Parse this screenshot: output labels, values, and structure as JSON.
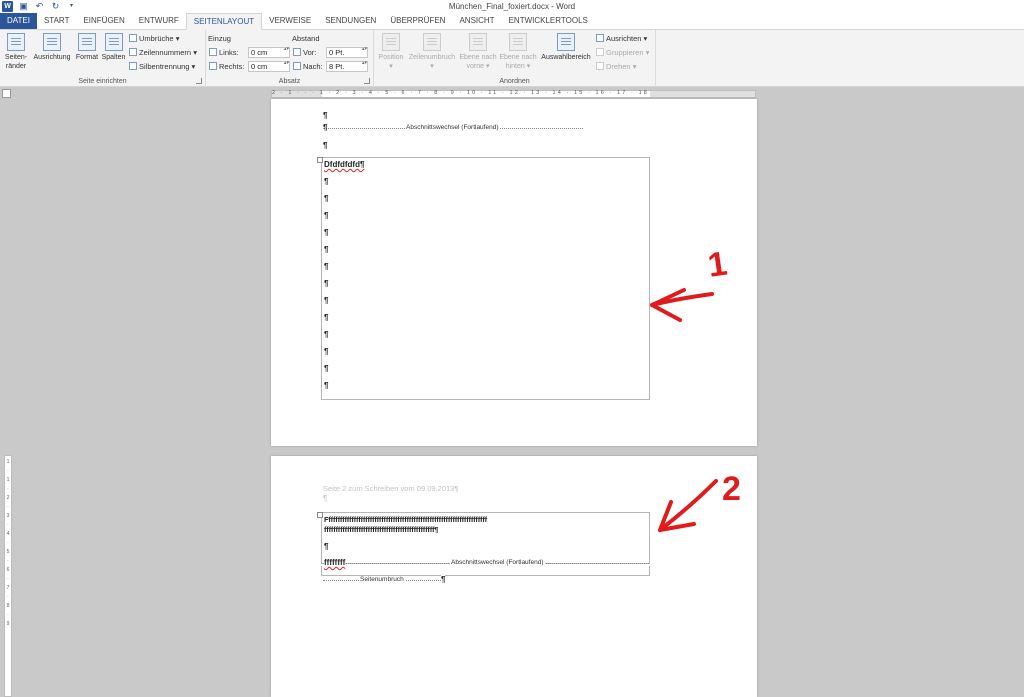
{
  "window": {
    "title": "München_Final_foxiert.docx - Word"
  },
  "tabs": [
    "DATEI",
    "START",
    "EINFÜGEN",
    "ENTWURF",
    "SEITENLAYOUT",
    "VERWEISE",
    "SENDUNGEN",
    "ÜBERPRÜFEN",
    "ANSICHT",
    "ENTWICKLERTOOLS"
  ],
  "ribbon": {
    "seite_einrichten": {
      "label": "Seite einrichten",
      "seitenraender_1": "Seiten-",
      "seitenraender_2": "ränder",
      "ausrichtung": "Ausrichtung",
      "format": "Format",
      "spalten": "Spalten",
      "umbrueche": "Umbrüche",
      "zeilennummern": "Zeilennummern",
      "silbentrennung": "Silbentrennung"
    },
    "absatz": {
      "label": "Absatz",
      "einzug": "Einzug",
      "abstand": "Abstand",
      "links_label": "Links:",
      "links_value": "0 cm",
      "rechts_label": "Rechts:",
      "rechts_value": "0 cm",
      "vor_label": "Vor:",
      "vor_value": "0 Pt.",
      "nach_label": "Nach:",
      "nach_value": "8 Pt."
    },
    "anordnen": {
      "label": "Anordnen",
      "position": "Position",
      "zeilenumbruch": "Zeilenumbruch",
      "ebene_vorne_1": "Ebene nach",
      "ebene_vorne_2": "vorne",
      "ebene_hinten_1": "Ebene nach",
      "ebene_hinten_2": "hinten",
      "auswahlbereich": "Auswahlbereich",
      "ausrichten": "Ausrichten",
      "gruppieren": "Gruppieren",
      "drehen": "Drehen"
    }
  },
  "ruler": {
    "numbers": "2 · 1 · · · 1 · 2 · 3 · 4 · 5 · 6 · 7 · 8 · 9 · 10 · 11 · 12 · 13 · 14 · 15 · 16 · 17 · 18",
    "vertical_numbers": [
      "1",
      "·",
      "1",
      "·",
      "2",
      "·",
      "3",
      "·",
      "4",
      "·",
      "5",
      "·",
      "6",
      "·",
      "7",
      "·",
      "8",
      "·",
      "9"
    ]
  },
  "document": {
    "pilcrow": "¶",
    "section_break_label": "Abschnittswechsel (Fortlaufend)",
    "frame1_heading": "Dfdfdfdfd¶",
    "page2_header": "Seite 2 zum Schreiben vom 09.09.2013¶",
    "frame2_line1": "Ffffffffffffffffffffffffffffffffffffffffffffffffffffffffffffffffffffff",
    "frame2_line2": "ffffffffffffffffffffffffffffffffffffffffffffffff¶",
    "frame2_last": "ffffffff",
    "page_break_label": "Seitenumbruch"
  },
  "annotations": {
    "label1": "1",
    "label2": "2",
    "color": "#e01b1b"
  }
}
